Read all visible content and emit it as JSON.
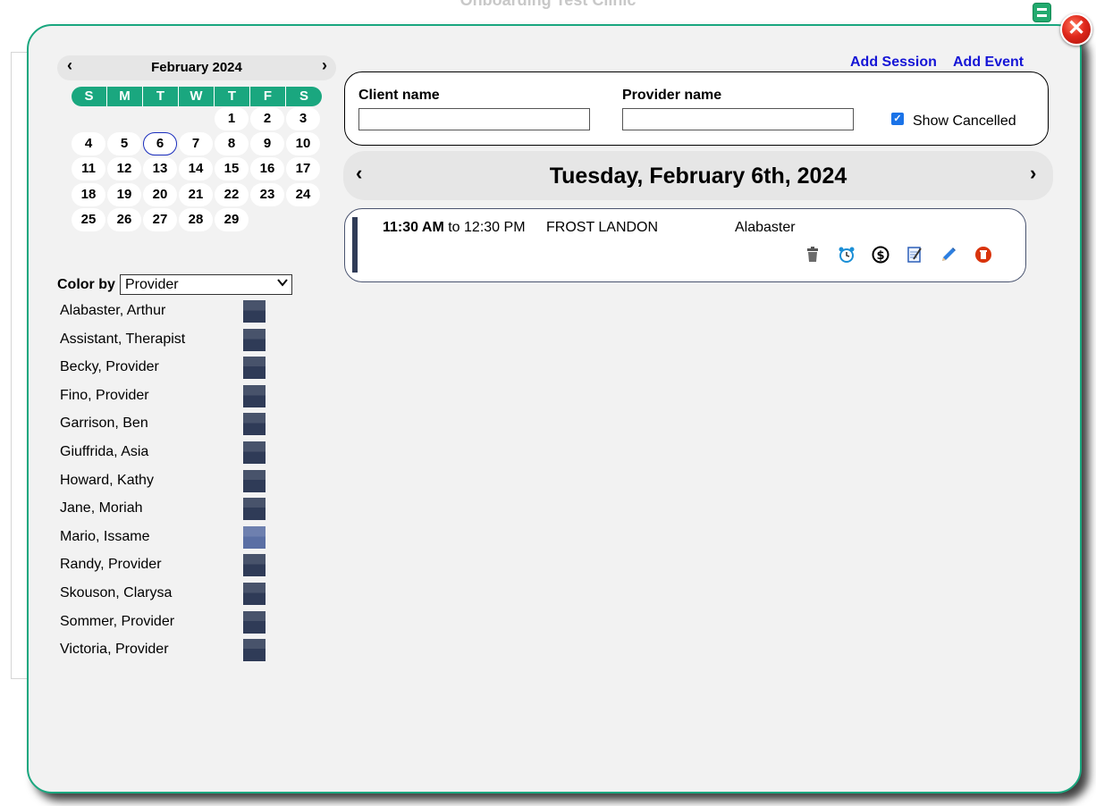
{
  "window": {
    "background_title": "Onboarding Test Clinic"
  },
  "calendar": {
    "month_label": "February 2024",
    "prev": "‹",
    "next": "›",
    "weekdays": [
      "S",
      "M",
      "T",
      "W",
      "T",
      "F",
      "S"
    ],
    "days": [
      "1",
      "2",
      "3",
      "4",
      "5",
      "6",
      "7",
      "8",
      "9",
      "10",
      "11",
      "12",
      "13",
      "14",
      "15",
      "16",
      "17",
      "18",
      "19",
      "20",
      "21",
      "22",
      "23",
      "24",
      "25",
      "26",
      "27",
      "28",
      "29"
    ],
    "selected_day": "6"
  },
  "color_by": {
    "label": "Color by",
    "selected": "Provider",
    "providers": [
      {
        "name": "Alabaster, Arthur",
        "color": "#2f3b57"
      },
      {
        "name": "Assistant, Therapist",
        "color": "#2f3b57"
      },
      {
        "name": "Becky, Provider",
        "color": "#2f3b57"
      },
      {
        "name": "Fino, Provider",
        "color": "#2f3b57"
      },
      {
        "name": "Garrison, Ben",
        "color": "#2f3b57"
      },
      {
        "name": "Giuffrida, Asia",
        "color": "#2f3b57"
      },
      {
        "name": "Howard, Kathy",
        "color": "#2f3b57"
      },
      {
        "name": "Jane, Moriah",
        "color": "#2f3b57"
      },
      {
        "name": "Mario, Issame",
        "color": "#5a6fa4"
      },
      {
        "name": "Randy, Provider",
        "color": "#2f3b57"
      },
      {
        "name": "Skouson, Clarysa",
        "color": "#2f3b57"
      },
      {
        "name": "Sommer, Provider",
        "color": "#2f3b57"
      },
      {
        "name": "Victoria, Provider",
        "color": "#2f3b57"
      }
    ]
  },
  "actions": {
    "add_session": "Add Session",
    "add_event": "Add Event"
  },
  "filters": {
    "client_label": "Client name",
    "client_value": "",
    "provider_label": "Provider name",
    "provider_value": "",
    "show_cancelled_label": "Show Cancelled",
    "show_cancelled_checked": true
  },
  "day_view": {
    "date_title": "Tuesday, February 6th, 2024",
    "prev": "‹",
    "next": "›"
  },
  "session": {
    "start": "11:30 AM",
    "to": "to",
    "end": "12:30 PM",
    "client": "FROST LANDON",
    "provider": "Alabaster",
    "icons": [
      "trash-icon",
      "alarm-clock-icon",
      "dollar-icon",
      "notepad-icon",
      "pencil-icon",
      "delete-icon"
    ]
  },
  "colors": {
    "accent": "#1aa77f",
    "link": "#1515d6",
    "provider_default": "#2f3b57"
  }
}
